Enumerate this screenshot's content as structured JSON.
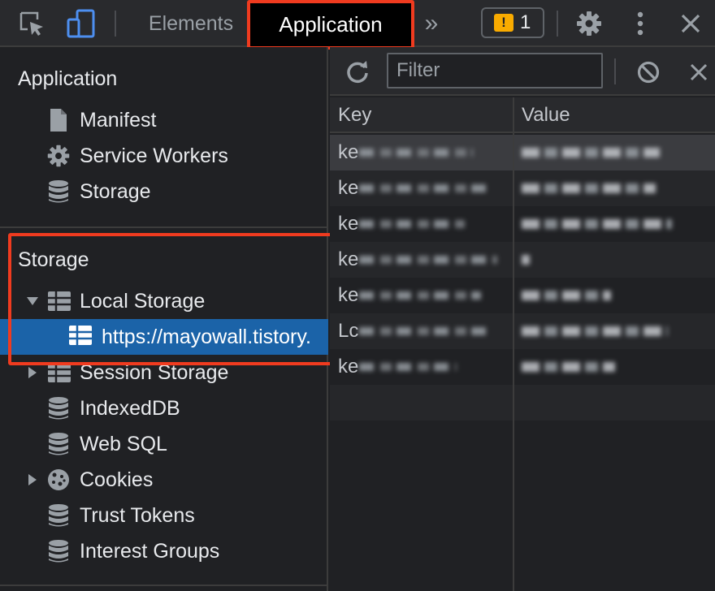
{
  "toolbar": {
    "tabs": {
      "elements": "Elements",
      "application": "Application"
    },
    "more_tabs": "»",
    "issues": {
      "count": "1"
    }
  },
  "sidebar": {
    "application_section": {
      "title": "Application",
      "items": [
        "Manifest",
        "Service Workers",
        "Storage"
      ]
    },
    "storage_section": {
      "title": "Storage",
      "local_storage": "Local Storage",
      "local_storage_origin": "https://mayowall.tistory.",
      "items": [
        "Session Storage",
        "IndexedDB",
        "Web SQL",
        "Cookies",
        "Trust Tokens",
        "Interest Groups"
      ]
    }
  },
  "panel": {
    "filter_placeholder": "Filter",
    "columns": {
      "key": "Key",
      "value": "Value"
    },
    "rows": [
      {
        "key": "ke",
        "value": ""
      },
      {
        "key": "ke",
        "value": ""
      },
      {
        "key": "ke",
        "value": ""
      },
      {
        "key": "ke",
        "value": ""
      },
      {
        "key": "ke",
        "value": ""
      },
      {
        "key": "Lc",
        "value": ""
      },
      {
        "key": "ke",
        "value": ""
      }
    ]
  },
  "colors": {
    "highlight_box": "#f03b1f",
    "selection": "#1b63a8",
    "background": "#202124"
  }
}
